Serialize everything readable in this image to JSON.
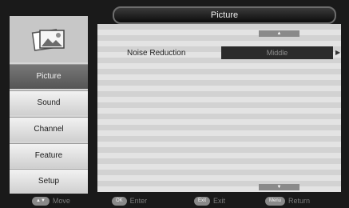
{
  "header": {
    "title": "Picture"
  },
  "sidebar": {
    "items": [
      {
        "label": "Picture",
        "selected": true
      },
      {
        "label": "Sound",
        "selected": false
      },
      {
        "label": "Channel",
        "selected": false
      },
      {
        "label": "Feature",
        "selected": false
      },
      {
        "label": "Setup",
        "selected": false
      }
    ]
  },
  "main": {
    "rows": [
      {
        "label": "Noise Reduction",
        "value": "Middle"
      }
    ],
    "scroll_up_glyph": "▲",
    "scroll_down_glyph": "▼",
    "row_arrow_glyph": "▶"
  },
  "footer": {
    "hints": [
      {
        "key": "▲▼",
        "label": "Move"
      },
      {
        "key": "OK",
        "label": "Enter"
      },
      {
        "key": "Exit",
        "label": "Exit"
      },
      {
        "key": "Menu",
        "label": "Return"
      }
    ]
  },
  "colors": {
    "selected_menu": "#666666",
    "value_box": "#2b2b2b",
    "header_bg": "#111111"
  }
}
